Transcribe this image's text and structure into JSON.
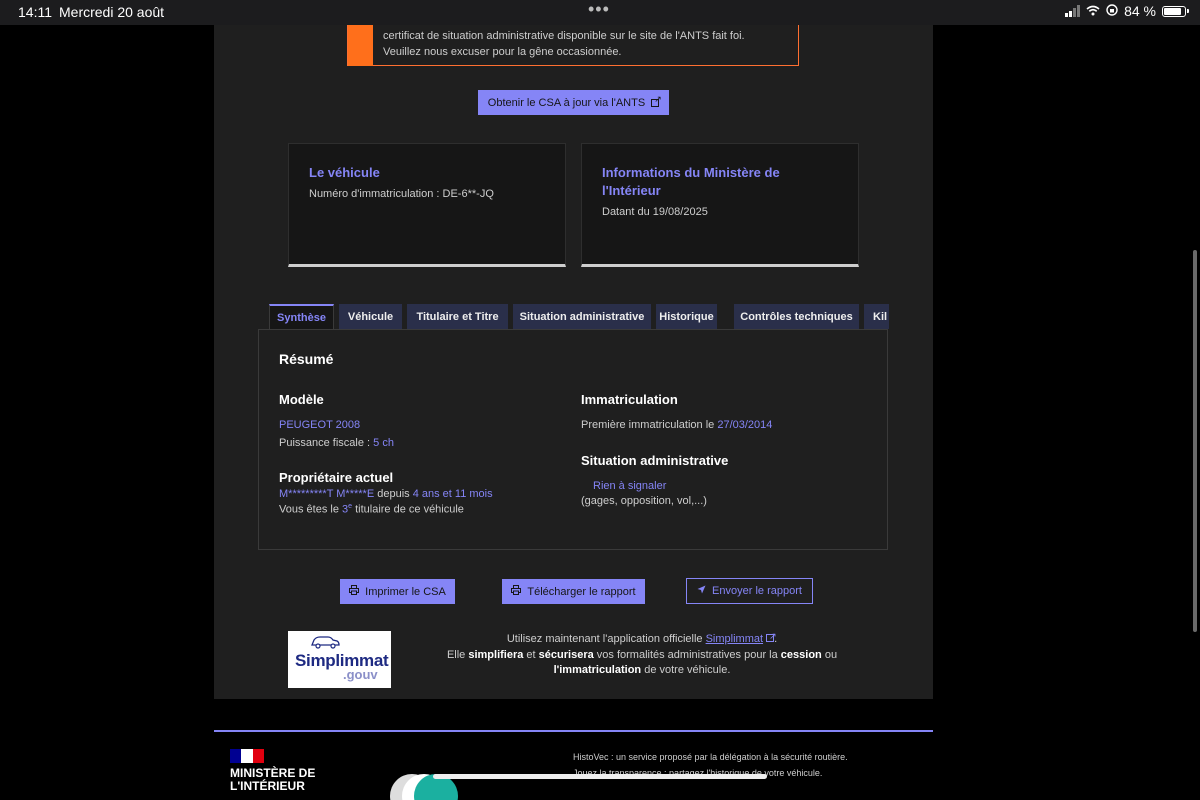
{
  "status_bar": {
    "time": "14:11",
    "date": "Mercredi 20 août",
    "battery": "84 %"
  },
  "alert": {
    "line1": "certificat de situation administrative disponible sur le site de l'ANTS fait foi.",
    "line2": "Veuillez nous excuser pour la gêne occasionnée."
  },
  "ants_button": "Obtenir le CSA à jour via l'ANTS",
  "vehicle_card": {
    "title": "Le véhicule",
    "plate": "Numéro d'immatriculation : DE-6**-JQ"
  },
  "ministry_card": {
    "title": "Informations du Ministère de l'Intérieur",
    "date": "Datant du 19/08/2025"
  },
  "tabs": [
    {
      "label": "Synthèse",
      "active": true
    },
    {
      "label": "Véhicule"
    },
    {
      "label": "Titulaire et Titre"
    },
    {
      "label": "Situation administrative"
    },
    {
      "label": "Historique"
    },
    {
      "label": "Contrôles techniques"
    },
    {
      "label": "Kil"
    }
  ],
  "summary": {
    "title": "Résumé",
    "model_title": "Modèle",
    "model": "PEUGEOT 2008",
    "fiscal_label": "Puissance fiscale : ",
    "fiscal_value": "5 ch",
    "owner_title": "Propriétaire actuel",
    "owner_name": "M*********T M*****E",
    "since_label": " depuis ",
    "since_value": "4 ans et 11 mois",
    "holder_prefix": "Vous êtes le ",
    "holder_rank": "3",
    "holder_sup": "e",
    "holder_suffix": " titulaire de ce véhicule",
    "immat_title": "Immatriculation",
    "first_immat_label": "Première immatriculation le ",
    "first_immat_date": "27/03/2014",
    "situation_title": "Situation administrative",
    "situation_value": "Rien à signaler",
    "situation_detail": "(gages, opposition, vol,...)"
  },
  "actions": {
    "print": "Imprimer le CSA",
    "download": "Télécharger le rapport",
    "send": "Envoyer le rapport"
  },
  "promo": {
    "intro": "Utilisez maintenant l'application officielle ",
    "app_link": "Simplimmat",
    "l2_a": "Elle ",
    "l2_b": "simplifiera",
    "l2_c": " et ",
    "l2_d": "sécurisera",
    "l2_e": " vos formalités administratives pour la ",
    "l2_f": "cession",
    "l2_g": " ou",
    "l3_a": "l'immatriculation",
    "l3_b": " de votre véhicule."
  },
  "logo": {
    "name": "Simplimmat",
    "suffix": ".gouv"
  },
  "footer": {
    "ministry": "MINISTÈRE DE L'INTÉRIEUR",
    "note1": "HistoVec : un service proposé par la délégation à la sécurité routière.",
    "note2": "Jouez la transparence : partagez l'historique de votre véhicule."
  },
  "colors": {
    "accent": "#8585f6",
    "warning": "#ff6f1b",
    "flag_blue": "#000091",
    "flag_red": "#e1000f"
  }
}
